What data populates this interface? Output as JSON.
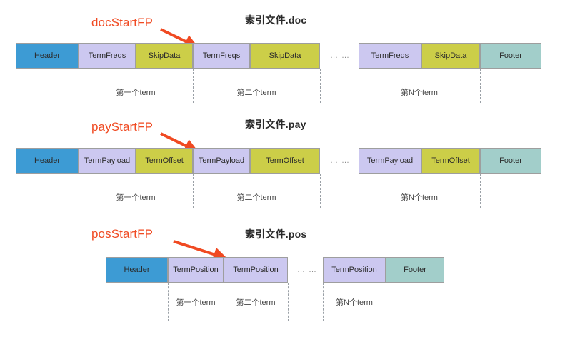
{
  "colors": {
    "header": "#3d9bd4",
    "lavender": "#ccc8f0",
    "olive": "#ccce48",
    "teal": "#a2ceca",
    "callout": "#f04a22",
    "border": "#9e9e9e",
    "dashed": "#9aa0a6",
    "background": "#ffffff"
  },
  "sections": [
    {
      "id": "doc",
      "title": "索引文件.doc",
      "callout": "docStartFP",
      "ellipsis": "… …",
      "cells": [
        {
          "label": "Header",
          "color": "header"
        },
        {
          "label": "TermFreqs",
          "color": "lavender"
        },
        {
          "label": "SkipData",
          "color": "olive"
        },
        {
          "label": "TermFreqs",
          "color": "lavender"
        },
        {
          "label": "SkipData",
          "color": "olive"
        },
        {
          "label": "TermFreqs",
          "color": "lavender"
        },
        {
          "label": "SkipData",
          "color": "olive"
        },
        {
          "label": "Footer",
          "color": "teal"
        }
      ],
      "captions": [
        "第一个term",
        "第二个term",
        "第N个term"
      ]
    },
    {
      "id": "pay",
      "title": "索引文件.pay",
      "callout": "payStartFP",
      "ellipsis": "… …",
      "cells": [
        {
          "label": "Header",
          "color": "header"
        },
        {
          "label": "TermPayload",
          "color": "lavender"
        },
        {
          "label": "TermOffset",
          "color": "olive"
        },
        {
          "label": "TermPayload",
          "color": "lavender"
        },
        {
          "label": "TermOffset",
          "color": "olive"
        },
        {
          "label": "TermPayload",
          "color": "lavender"
        },
        {
          "label": "TermOffset",
          "color": "olive"
        },
        {
          "label": "Footer",
          "color": "teal"
        }
      ],
      "captions": [
        "第一个term",
        "第二个term",
        "第N个term"
      ]
    },
    {
      "id": "pos",
      "title": "索引文件.pos",
      "callout": "posStartFP",
      "ellipsis": "… …",
      "cells": [
        {
          "label": "Header",
          "color": "header"
        },
        {
          "label": "TermPosition",
          "color": "lavender"
        },
        {
          "label": "TermPosition",
          "color": "lavender"
        },
        {
          "label": "TermPosition",
          "color": "lavender"
        },
        {
          "label": "Footer",
          "color": "teal"
        }
      ],
      "captions": [
        "第一个term",
        "第二个term",
        "第N个term"
      ]
    }
  ]
}
